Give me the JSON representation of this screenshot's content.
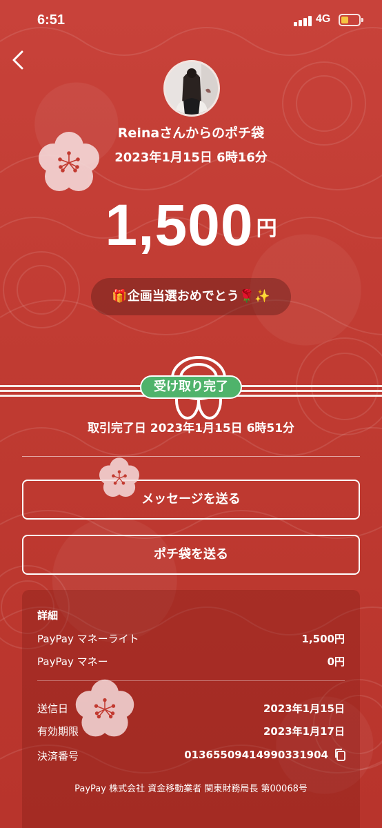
{
  "status": {
    "time": "6:51",
    "network": "4G"
  },
  "header": {
    "sender_line": "Reinaさんからのポチ袋",
    "date": "2023年1月15日 6時16分"
  },
  "amount": {
    "value": "1,500",
    "unit": "円"
  },
  "message": "🎁企画当選おめでとう🌹✨",
  "badge": "受け取り完了",
  "completed": "取引完了日 2023年1月15日 6時51分",
  "actions": {
    "message_label": "メッセージを送る",
    "send_label": "ポチ袋を送る"
  },
  "details": {
    "title": "詳細",
    "balance_rows": [
      {
        "label": "PayPay マネーライト",
        "value": "1,500円"
      },
      {
        "label": "PayPay マネー",
        "value": "0円"
      }
    ],
    "info_rows": [
      {
        "label": "送信日",
        "value": "2023年1月15日"
      },
      {
        "label": "有効期限",
        "value": "2023年1月17日"
      },
      {
        "label": "決済番号",
        "value": "01365509414990331904"
      }
    ],
    "footer": "PayPay 株式会社 資金移動業者 関東財務局長 第00068号"
  },
  "colors": {
    "background": "#c23a30",
    "badge": "#4fb36b",
    "blossom": "#f6dcdc"
  },
  "icons": [
    "back-chevron-icon",
    "plum-blossom-icon",
    "mizuhiki-knot-icon",
    "copy-icon"
  ]
}
